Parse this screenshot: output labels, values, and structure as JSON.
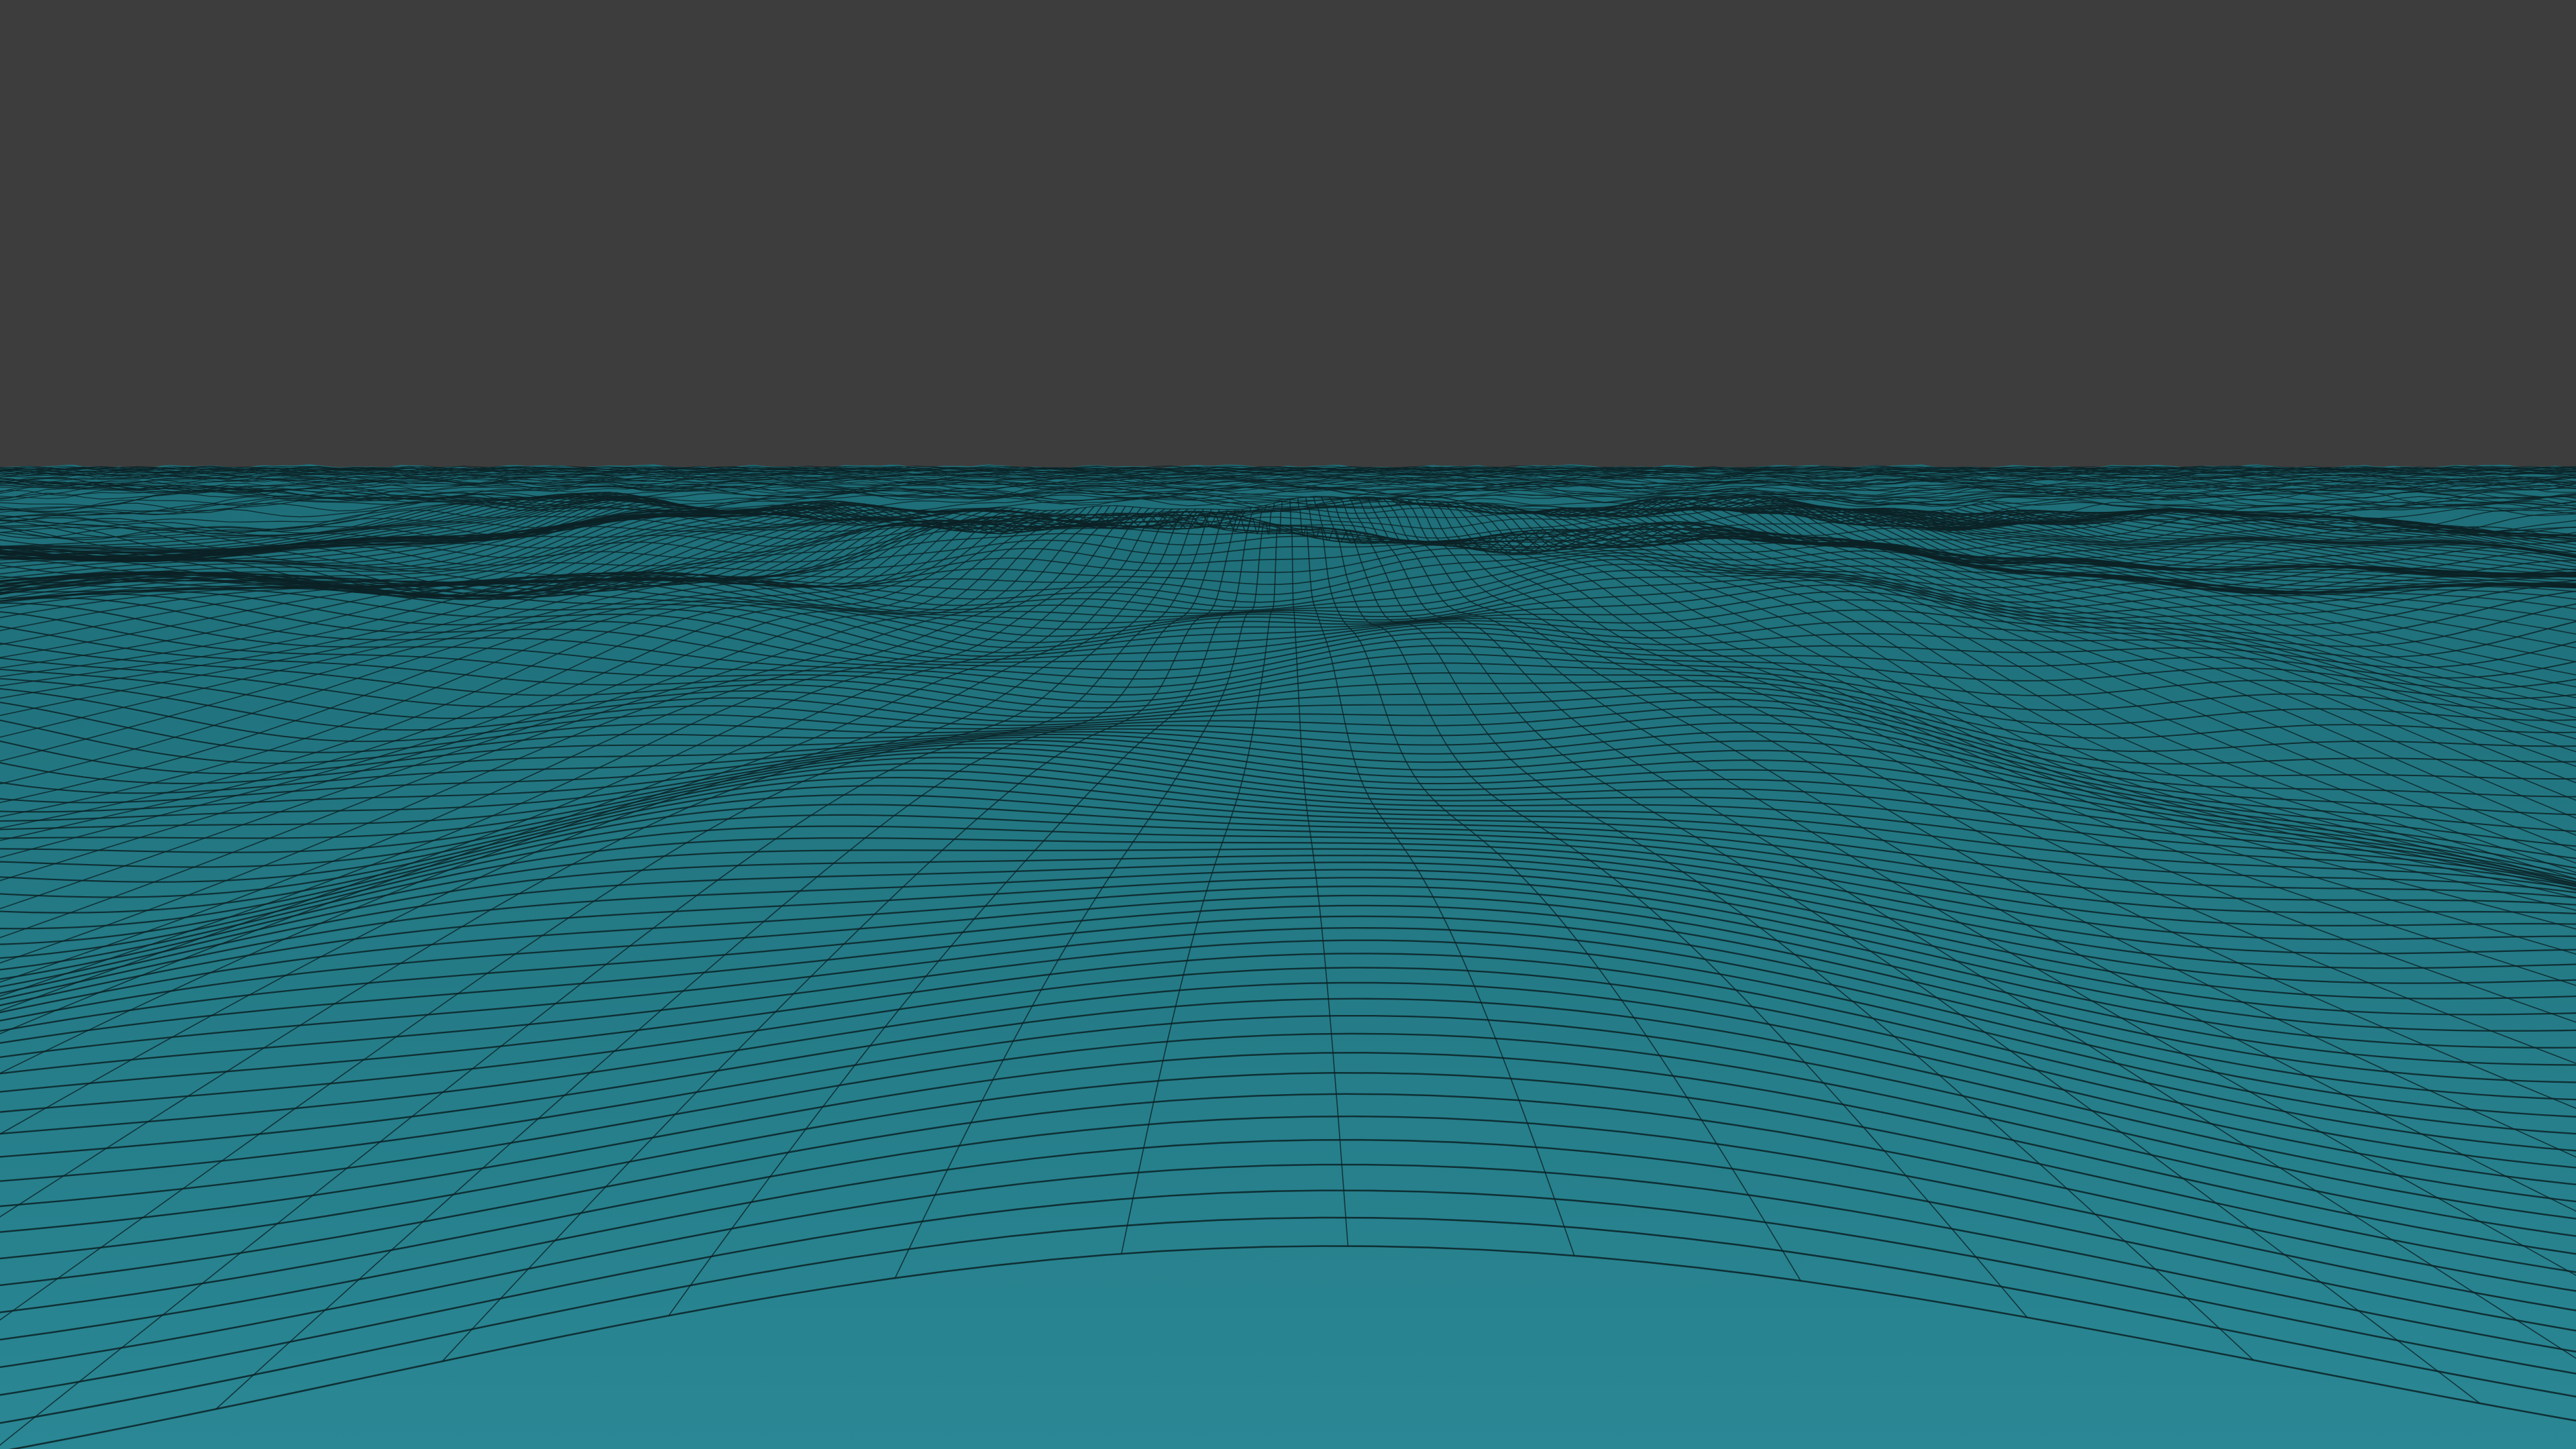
{
  "viewport": {
    "background_color": "#3d3d3d"
  },
  "mesh": {
    "surface_color_far": "#1e6e78",
    "surface_color_near": "#2a8794",
    "wire_color": "#0b2226",
    "shading": "solid-with-wireframe"
  }
}
